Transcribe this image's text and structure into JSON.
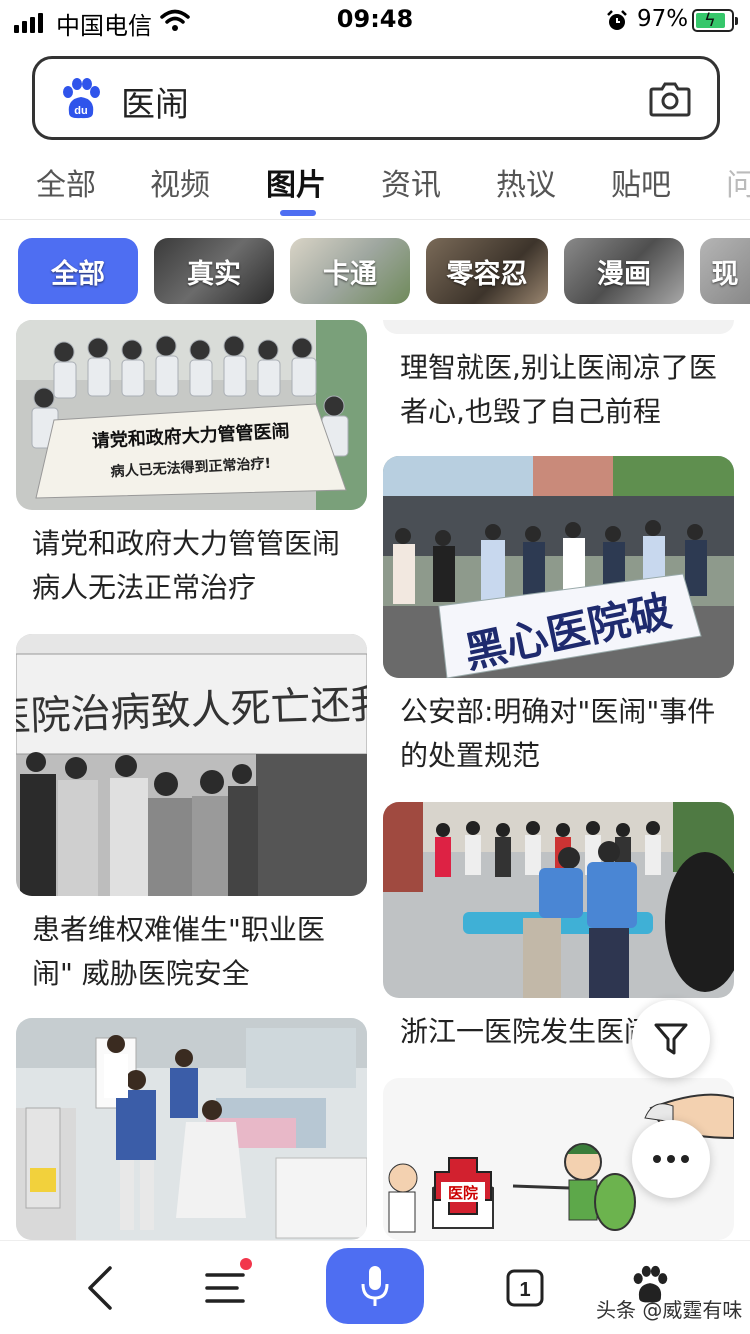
{
  "status": {
    "carrier": "中国电信",
    "time": "09:48",
    "battery_pct": "97%",
    "battery_level": 0.97
  },
  "search": {
    "logo_icon": "baidu-paw-icon",
    "query": "医闹",
    "camera_icon": "camera-icon"
  },
  "tabs": [
    {
      "label": "全部"
    },
    {
      "label": "视频"
    },
    {
      "label": "图片",
      "active": true
    },
    {
      "label": "资讯"
    },
    {
      "label": "热议"
    },
    {
      "label": "贴吧"
    },
    {
      "label": "问"
    }
  ],
  "chips": [
    {
      "label": "全部",
      "active": true
    },
    {
      "label": "真实"
    },
    {
      "label": "卡通"
    },
    {
      "label": "零容忍"
    },
    {
      "label": "漫画"
    },
    {
      "label": "现"
    }
  ],
  "left_column": [
    {
      "title": "请党和政府大力管管医闹病人无法正常治疗",
      "banner": "请党和政府大力管管医闹",
      "banner_sub": "病人已无法得到正常治疗!"
    },
    {
      "title": "患者维权难催生\"职业医闹\" 威胁医院安全",
      "banner": "医院治病致人死亡还我"
    },
    {
      "title": ""
    }
  ],
  "right_column": [
    {
      "title": "理智就医,别让医闹凉了医者心,也毁了自己前程"
    },
    {
      "title": "公安部:明确对\"医闹\"事件的处置规范",
      "banner": "黑心医院破"
    },
    {
      "title": "浙江一医院发生医闹事件"
    },
    {
      "title": "",
      "sign": "医院"
    }
  ],
  "floating": {
    "filter_icon": "filter-icon",
    "more_icon": "more-dots-icon"
  },
  "bottom_bar": {
    "back_icon": "back-chevron-icon",
    "menu_icon": "menu-icon",
    "mic_icon": "microphone-icon",
    "tab_count": "1",
    "home_icon": "baidu-paw-icon",
    "watermark": "头条 @威霆有味"
  },
  "colors": {
    "accent": "#4e6ef2",
    "notification_dot": "#f2364b",
    "battery_green": "#36c76b"
  }
}
